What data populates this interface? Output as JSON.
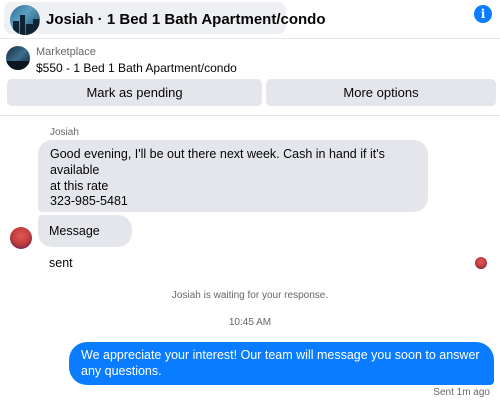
{
  "header": {
    "title": "Josiah · 1 Bed 1 Bath Apartment/condo",
    "info_icon": "info-icon"
  },
  "listing": {
    "source": "Marketplace",
    "title": "$550 - 1 Bed 1 Bath Apartment/condo"
  },
  "actions": {
    "mark_pending": "Mark as pending",
    "more_options": "More options"
  },
  "conversation": {
    "sender_name": "Josiah",
    "incoming": [
      {
        "line1": "Good evening, I'll be out there next week. Cash in hand if it's available",
        "line2": "at this rate",
        "phone": "323-985-5481"
      },
      {
        "text": "Message sent"
      }
    ],
    "system_note": "Josiah is waiting for your response.",
    "timestamp": "10:45 AM",
    "outgoing": {
      "text": "We appreciate your interest! Our team will message you soon to answer any questions.",
      "status": "Sent 1m ago"
    }
  },
  "colors": {
    "accent": "#0a7cff",
    "bubble_incoming": "#e4e6eb",
    "button_bg": "#e4e6eb",
    "muted_text": "#65676b"
  }
}
